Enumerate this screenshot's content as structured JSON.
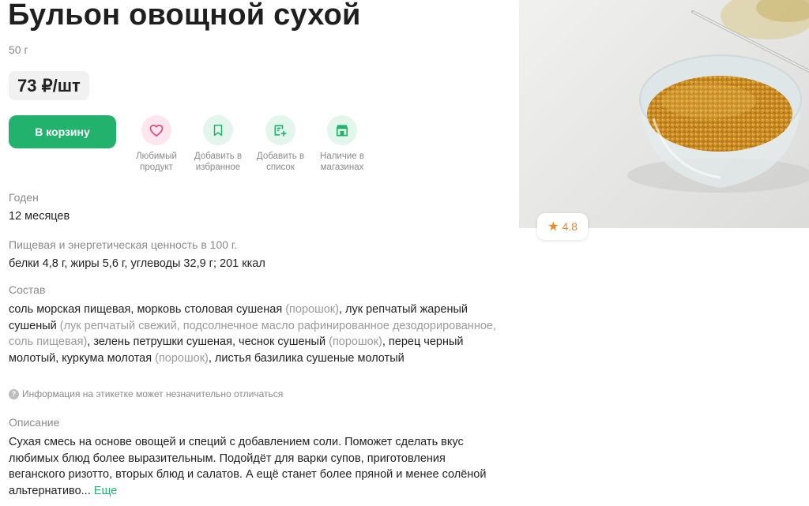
{
  "product": {
    "title": "Бульон овощной сухой",
    "weight": "50 г",
    "price": "73 ₽/шт"
  },
  "actions": {
    "cart_label": "В корзину",
    "favorite": {
      "label": "Любимый продукт",
      "icon": "heart-icon"
    },
    "bookmark": {
      "label": "Добавить в избранное",
      "icon": "bookmark-icon"
    },
    "add_list": {
      "label": "Добавить в список",
      "icon": "list-add-icon"
    },
    "stores": {
      "label": "Наличие в магазинах",
      "icon": "store-icon"
    }
  },
  "details": {
    "shelf_label": "Годен",
    "shelf_value": "12 месяцев",
    "nutrition_label": "Пищевая и энергетическая ценность в 100 г.",
    "nutrition_value": "белки 4,8 г, жиры 5,6 г, углеводы 32,9 г; 201 ккал",
    "composition_label": "Состав",
    "composition": {
      "p1": "соль морская пищевая, морковь столовая сушеная ",
      "p2": "(порошок)",
      "p3": ", лук репчатый жареный сушеный ",
      "p4": "(лук репчатый свежий, подсолнечное масло рафинированное дезодорированное, соль пищевая)",
      "p5": ", зелень петрушки сушеная, чеснок сушеный ",
      "p6": "(порошок)",
      "p7": ", перец черный молотый, куркума молотая ",
      "p8": "(порошок)",
      "p9": ", листья базилика сушеные молотый"
    },
    "label_note": "Информация на этикетке может незначительно отличаться",
    "description_label": "Описание",
    "description": "Сухая смесь на основе овощей и специй с добавлением соли. Поможет сделать вкус любимых блюд более выразительным. Подойдёт для варки супов, приготовления веганского ризотто, вторых блюд и салатов. А ещё станет более пряной и менее солёной альтернативо...",
    "more_label": "Еще"
  },
  "rating": {
    "value": "4.8",
    "icon": "star-icon"
  },
  "colors": {
    "accent_green": "#23b26d",
    "heart_pink": "#e24a7b",
    "rating_orange": "#f08a24"
  }
}
